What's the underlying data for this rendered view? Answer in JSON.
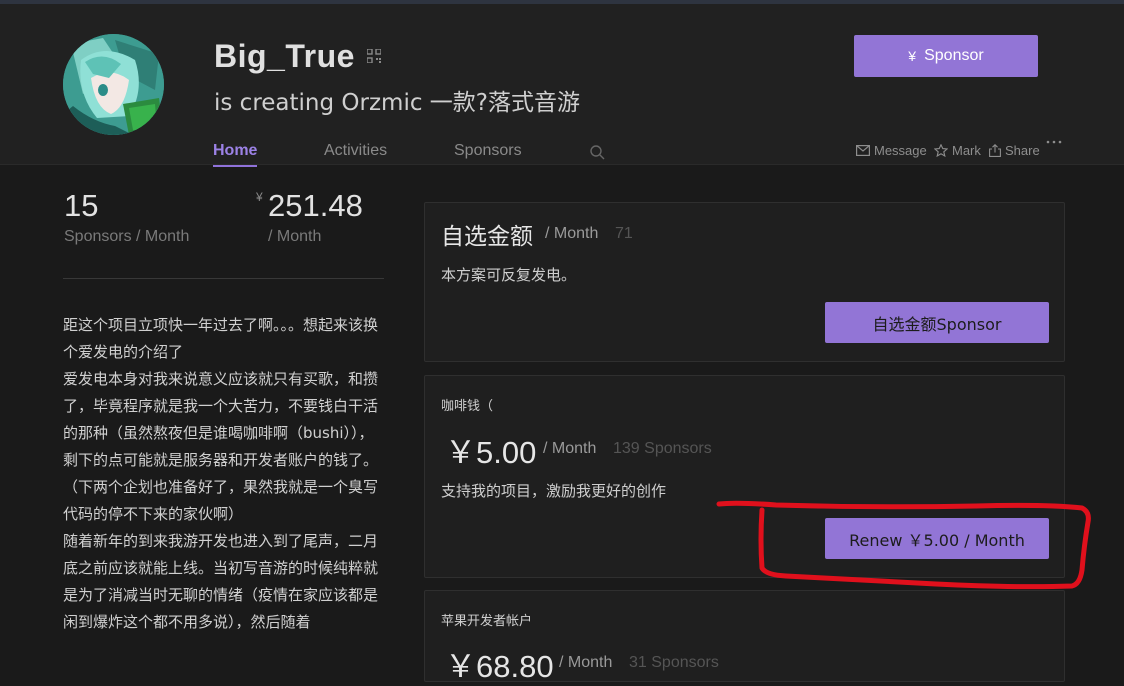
{
  "profile": {
    "username": "Big_True",
    "tagline": "is creating Orzmic 一款?落式音游",
    "sponsor_button": "Sponsor",
    "sponsor_currency": "¥"
  },
  "nav": {
    "tabs": [
      "Home",
      "Activities",
      "Sponsors"
    ],
    "active_tab": "Home",
    "actions": [
      "Message",
      "Mark",
      "Share"
    ]
  },
  "stats": {
    "sponsors_count": "15",
    "sponsors_label": "Sponsors / Month",
    "income_currency": "¥",
    "income_amount": "251.48",
    "income_label": "/ Month"
  },
  "description": [
    "距这个项目立项快一年过去了啊。。。想起来该换个爱发电的介绍了",
    "爱发电本身对我来说意义应该就只有买歌，和攒了，毕竟程序就是我一个大苦力，不要钱白干活的那种（虽然熬夜但是谁喝咖啡啊（bushi）），剩下的点可能就是服务器和开发者账户的钱了。",
    "（下两个企划也准备好了，果然我就是一个臭写代码的停不下来的家伙啊）",
    "随着新年的到来我游开发也进入到了尾声，二月底之前应该就能上线。当初写音游的时候纯粹就是为了消减当时无聊的情绪（疫情在家应该都是闲到爆炸这个都不用多说），然后随着"
  ],
  "tiers": [
    {
      "title": "自选金额",
      "per_month": "/ Month",
      "count": "71",
      "description": "本方案可反复发电。",
      "button": "自选金额Sponsor"
    },
    {
      "name": "咖啡钱（",
      "price": "￥5.00",
      "per_month": "/ Month",
      "count": "139 Sponsors",
      "description": "支持我的项目，激励我更好的创作",
      "button": "Renew ￥5.00 / Month"
    },
    {
      "name": "苹果开发者帐户",
      "price": "￥68.80",
      "per_month": "/ Month",
      "count": "31 Sponsors"
    }
  ],
  "colors": {
    "accent": "#9275d6",
    "accent_text": "#9c82e6",
    "background": "#1a1a1a",
    "header_bg": "#212121",
    "card_bg": "#1f1f1f",
    "annotation_red": "#e0101c"
  },
  "icons": [
    "qr-code-icon",
    "search-icon",
    "mail-icon",
    "star-icon",
    "share-icon",
    "more-icon"
  ]
}
